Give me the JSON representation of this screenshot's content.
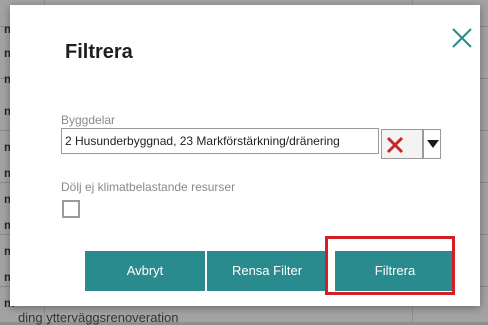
{
  "background": {
    "cell_chars": [
      "m",
      "m",
      "m",
      "m",
      "m",
      "m",
      "m",
      "m",
      "m",
      "m",
      "m"
    ],
    "bottom_text": "ding ytterväggsrenoveration"
  },
  "dialog": {
    "title": "Filtrera",
    "close_icon": "close-x-icon",
    "building_parts": {
      "label": "Byggdelar",
      "value": "2 Husunderbyggnad, 23 Markförstärkning/dränering"
    },
    "hide_non_climate": {
      "label": "Dölj ej klimatbelastande resurser",
      "checked": false
    },
    "buttons": {
      "cancel": "Avbryt",
      "clear_filter": "Rensa Filter",
      "apply": "Filtrera"
    }
  },
  "colors": {
    "accent": "#2a8b8f",
    "highlight": "#d32027",
    "clear_x": "#c62828"
  }
}
